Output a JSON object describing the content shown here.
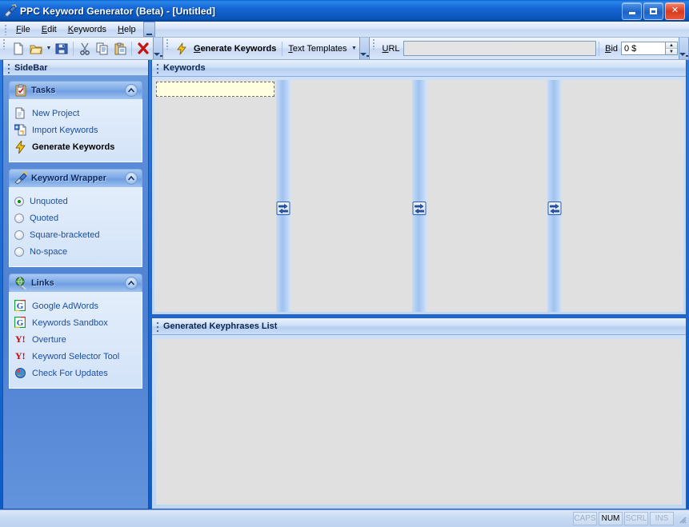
{
  "window": {
    "title": "PPC Keyword Generator (Beta) - [Untitled]",
    "icon": "app-brush-icon",
    "buttons": {
      "minimize": "Minimize",
      "maximize": "Maximize",
      "close": "Close"
    }
  },
  "menubar": {
    "items": [
      {
        "label": "File",
        "mnemonic": "F"
      },
      {
        "label": "Edit",
        "mnemonic": "E"
      },
      {
        "label": "Keywords",
        "mnemonic": "K"
      },
      {
        "label": "Help",
        "mnemonic": "H"
      }
    ],
    "overflow": "Toolbar Options"
  },
  "toolbar_standard": {
    "buttons": [
      {
        "name": "new-document-button",
        "tooltip": "New"
      },
      {
        "name": "open-folder-button",
        "tooltip": "Open"
      },
      {
        "name": "save-button",
        "tooltip": "Save"
      },
      {
        "name": "cut-button",
        "tooltip": "Cut"
      },
      {
        "name": "copy-button",
        "tooltip": "Copy"
      },
      {
        "name": "paste-button",
        "tooltip": "Paste"
      },
      {
        "name": "delete-button",
        "tooltip": "Delete"
      }
    ]
  },
  "toolbar_keywords": {
    "generate_label": "Generate Keywords",
    "generate_mnemonic": "G",
    "templates_label": "Text Templates",
    "templates_mnemonic": "T"
  },
  "toolbar_url": {
    "url_label": "URL",
    "url_mnemonic": "U",
    "url_value": "",
    "url_placeholder": "",
    "bid_label": "Bid",
    "bid_mnemonic": "B",
    "bid_value": "0 $"
  },
  "sidebar": {
    "title": "SideBar",
    "panels": [
      {
        "title": "Tasks",
        "icon": "clipboard-icon",
        "collapse_tooltip": "Collapse",
        "items": [
          {
            "label": "New Project",
            "icon": "new-document-icon",
            "bold": false
          },
          {
            "label": "Import Keywords",
            "icon": "import-keywords-icon",
            "bold": false
          },
          {
            "label": "Generate Keywords",
            "icon": "lightning-bolt-icon",
            "bold": true
          }
        ]
      },
      {
        "title": "Keyword Wrapper",
        "icon": "brush-icon",
        "collapse_tooltip": "Collapse",
        "options": [
          {
            "label": "Unquoted",
            "selected": true
          },
          {
            "label": "Quoted",
            "selected": false
          },
          {
            "label": "Square-bracketed",
            "selected": false
          },
          {
            "label": "No-space",
            "selected": false
          }
        ]
      },
      {
        "title": "Links",
        "icon": "globe-link-icon",
        "collapse_tooltip": "Collapse",
        "items": [
          {
            "label": "Google AdWords",
            "icon": "google-icon"
          },
          {
            "label": "Keywords Sandbox",
            "icon": "google-icon"
          },
          {
            "label": "Overture",
            "icon": "yahoo-icon"
          },
          {
            "label": "Keyword Selector Tool",
            "icon": "yahoo-icon"
          },
          {
            "label": "Check For Updates",
            "icon": "update-globe-icon"
          }
        ]
      }
    ]
  },
  "keywords_panel": {
    "title": "Keywords",
    "columns": [
      {
        "name": "keyword-column-1",
        "selected_row": true
      },
      {
        "name": "keyword-column-2",
        "selected_row": false
      },
      {
        "name": "keyword-column-3",
        "selected_row": false
      },
      {
        "name": "keyword-column-4",
        "selected_row": false
      }
    ],
    "splitter_tooltip": "Move items"
  },
  "generated_panel": {
    "title": "Generated Keyphrases List",
    "rows": []
  },
  "statusbar": {
    "message": "",
    "indicators": [
      {
        "label": "CAPS",
        "active": false
      },
      {
        "label": "NUM",
        "active": true
      },
      {
        "label": "SCRL",
        "active": false
      },
      {
        "label": "INS",
        "active": false
      }
    ]
  },
  "colors": {
    "titlebar_blue": "#1464D4",
    "sidebar_blue": "#5A8CD8",
    "panel_header": "#7FAAE6",
    "link_text": "#1A4FA0",
    "selection_row": "#FFFFE0",
    "list_bg": "#E0E0E0",
    "close_red": "#D9391C"
  }
}
